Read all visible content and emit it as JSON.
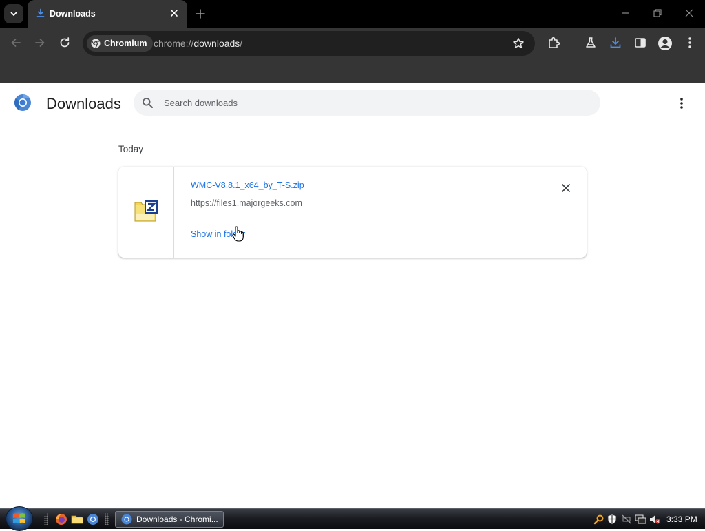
{
  "browser": {
    "tab": {
      "title": "Downloads"
    },
    "omnibox": {
      "chip_label": "Chromium",
      "url_scheme": "chrome://",
      "url_host": "downloads",
      "url_path": "/"
    }
  },
  "page": {
    "title": "Downloads",
    "search": {
      "placeholder": "Search downloads"
    },
    "groups": [
      {
        "date_label": "Today",
        "items": [
          {
            "file_name": "WMC-V8.8.1_x64_by_T-S.zip",
            "source_url": "https://files1.majorgeeks.com",
            "action_label": "Show in folder"
          }
        ]
      }
    ]
  },
  "taskbar": {
    "task_label": "Downloads - Chromi...",
    "clock": "3:33 PM"
  },
  "colors": {
    "link": "#1a73e8",
    "titlebar": "#000000",
    "toolbar": "#353535",
    "download_icon_active": "#4d8fe8"
  }
}
